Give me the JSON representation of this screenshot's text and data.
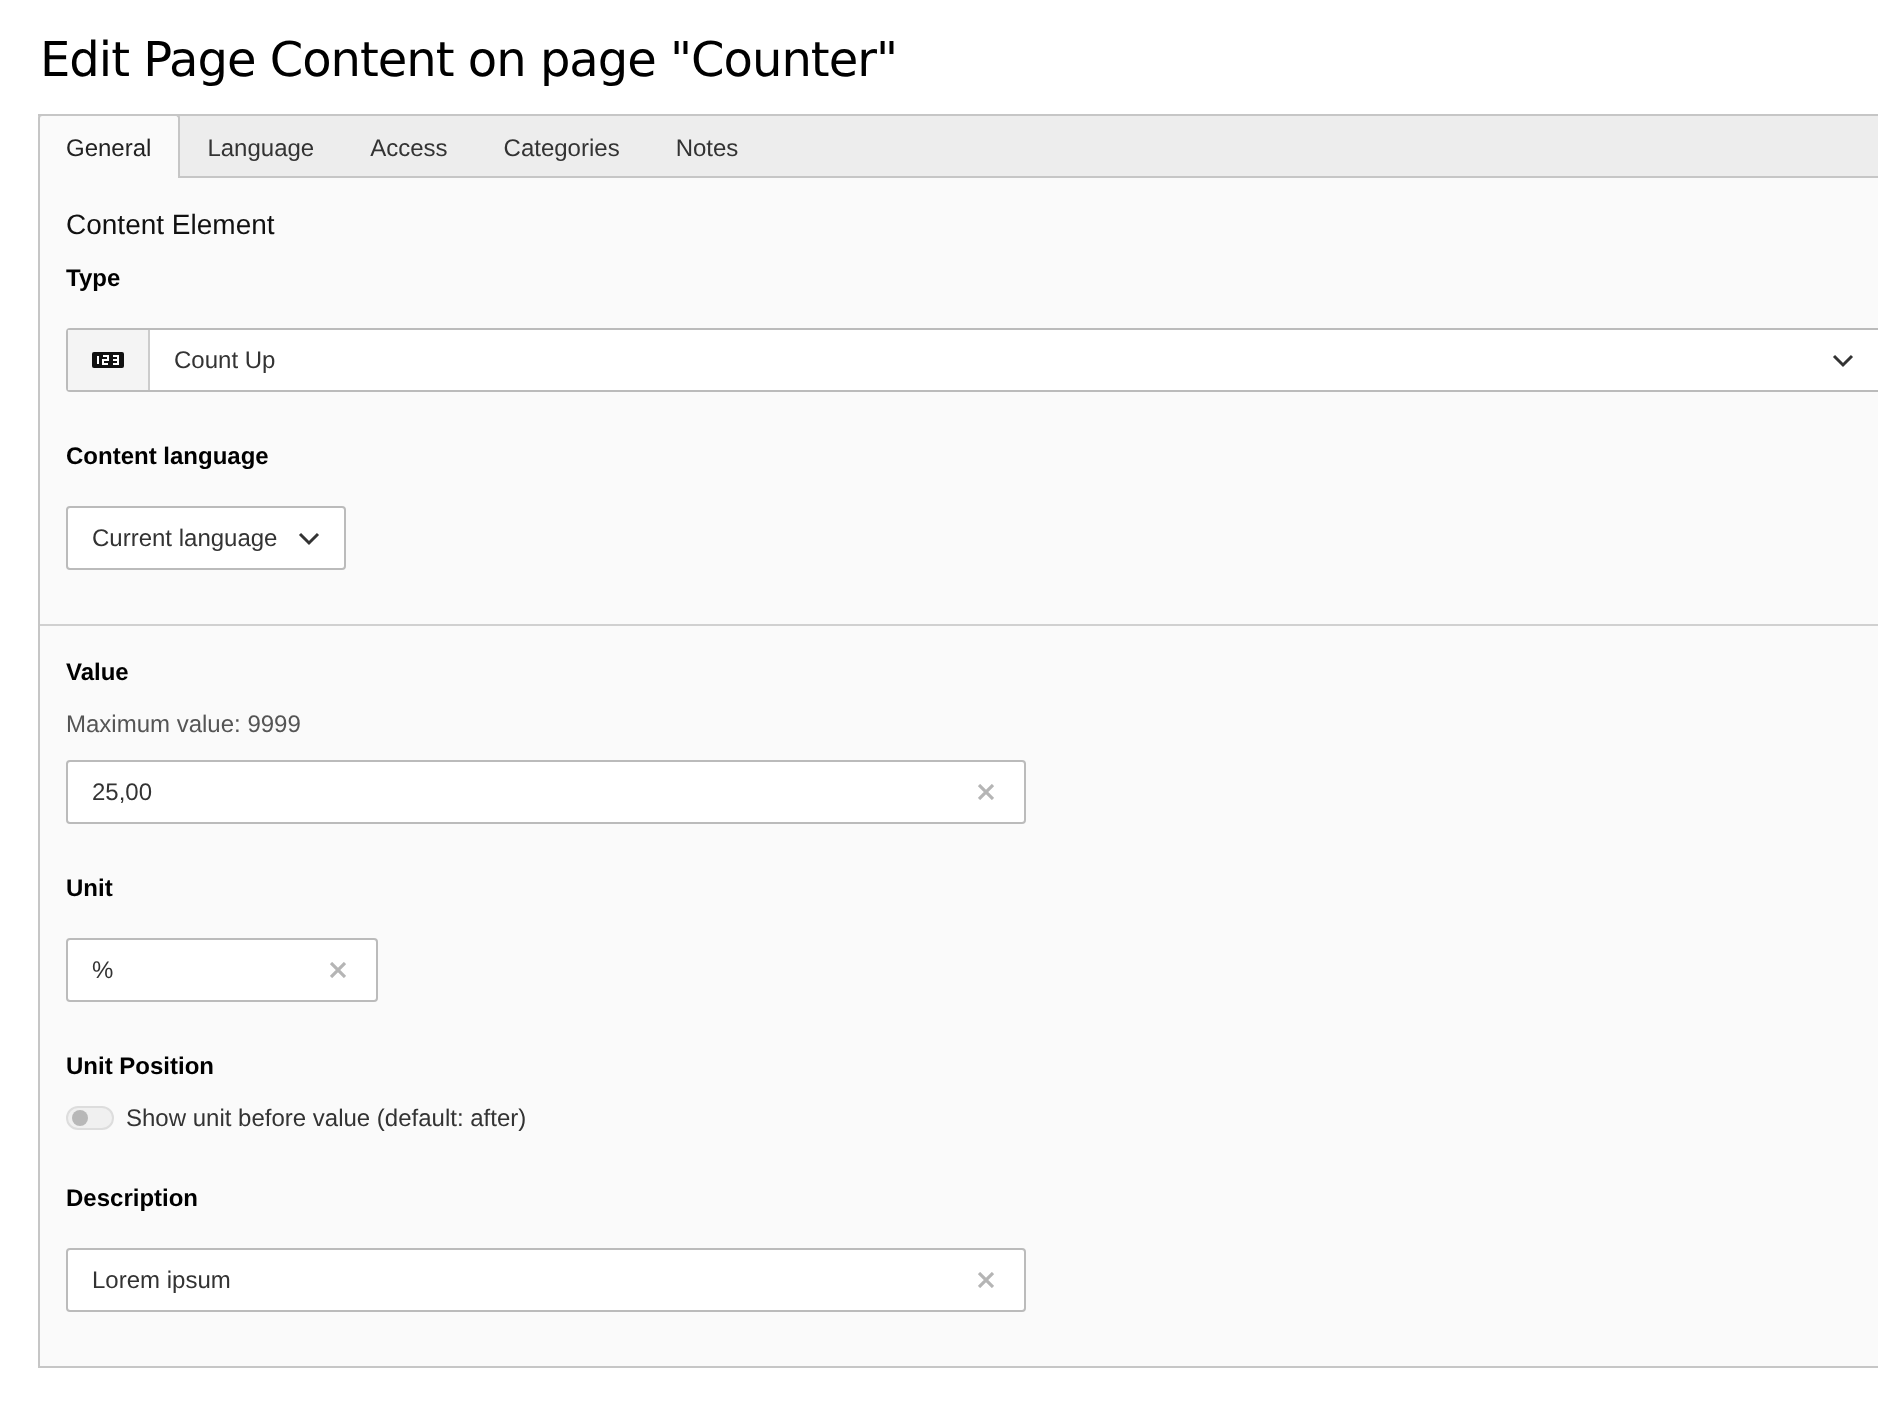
{
  "page_title": "Edit Page Content on page \"Counter\"",
  "tabs": [
    {
      "label": "General",
      "selected": true
    },
    {
      "label": "Language",
      "selected": false
    },
    {
      "label": "Access",
      "selected": false
    },
    {
      "label": "Categories",
      "selected": false
    },
    {
      "label": "Notes",
      "selected": false
    }
  ],
  "sections": [
    {
      "heading": "Content Element",
      "fields": [
        {
          "kind": "select",
          "label": "Type",
          "value": "Count Up"
        },
        {
          "kind": "dropdown",
          "label": "Content language",
          "value": "Current language"
        }
      ]
    },
    {
      "fields": [
        {
          "kind": "text",
          "label": "Value",
          "help": "Maximum value: 9999",
          "value": "25,00"
        },
        {
          "kind": "short",
          "label": "Unit",
          "value": "%"
        },
        {
          "kind": "toggle",
          "label": "Unit Position",
          "text": "Show unit before value (default: after)",
          "on": false
        },
        {
          "kind": "text",
          "label": "Description",
          "value": "Lorem ipsum"
        }
      ]
    }
  ]
}
